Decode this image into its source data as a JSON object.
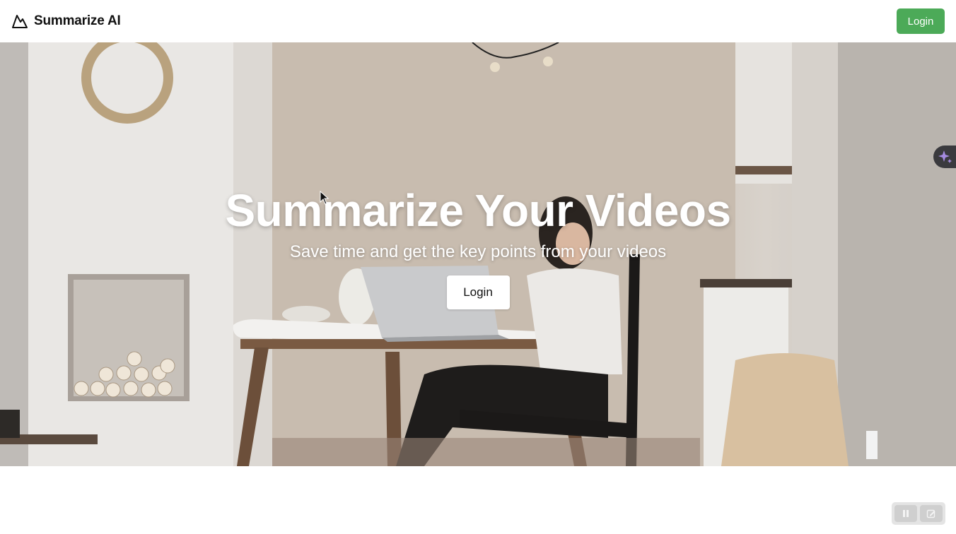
{
  "navbar": {
    "brand_name": "Summarize AI",
    "brand_icon": "mountain-icon",
    "login_label": "Login",
    "login_color": "#4caa58"
  },
  "hero": {
    "title": "Summarize Your Videos",
    "subtitle": "Save time and get the key points from your videos",
    "login_label": "Login",
    "background": "photo-woman-at-table-with-laptop"
  },
  "overlays": {
    "ai_assist_icon": "sparkle-icon",
    "recorder_icons": [
      "pause-icon",
      "edit-icon"
    ]
  }
}
